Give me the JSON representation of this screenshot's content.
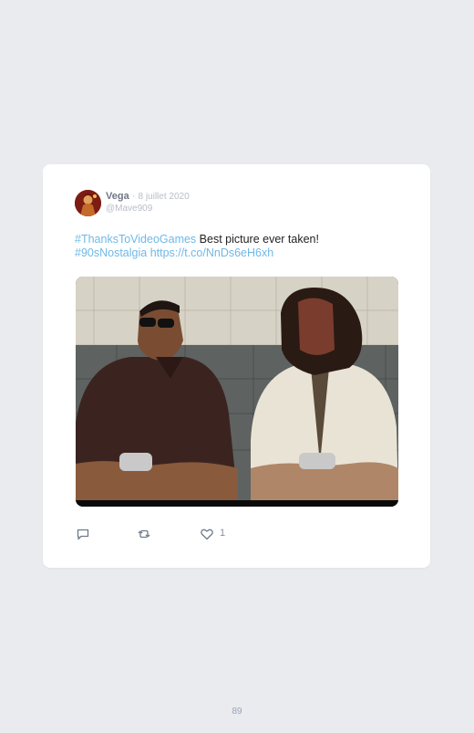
{
  "tweet": {
    "author_name": "Vega",
    "separator": "·",
    "date": "8 juillet 2020",
    "handle": "@Mave909",
    "hashtag_1": "#ThanksToVideoGames",
    "text_1": " Best picture ever taken!",
    "hashtag_2": "#90sNostalgia",
    "link": "https://t.co/NnDs6eH6xh",
    "like_count": "1"
  },
  "icons": {
    "reply": "reply-icon",
    "retweet": "retweet-icon",
    "like": "heart-icon"
  },
  "colors": {
    "link": "#6fb8e6",
    "background": "#e9ebef",
    "card": "#ffffff"
  },
  "page_number": "89"
}
